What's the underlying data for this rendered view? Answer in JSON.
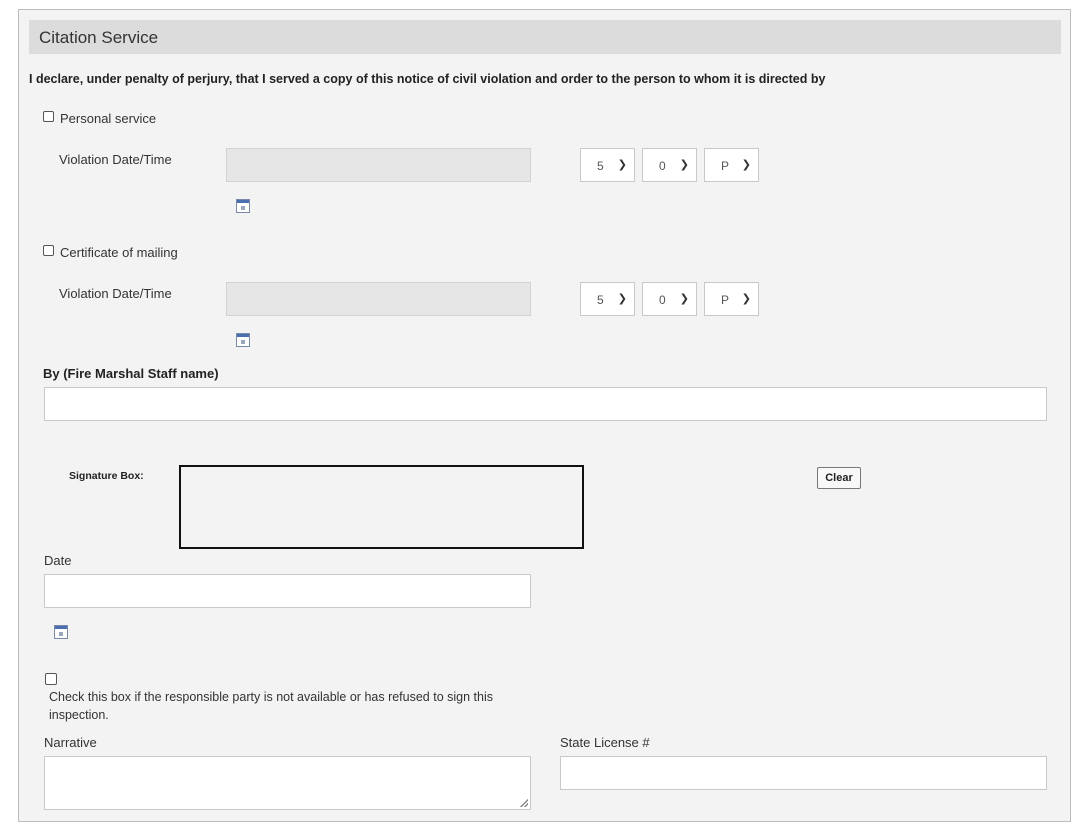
{
  "panel": {
    "title": "Citation Service"
  },
  "declaration": "I declare, under penalty of perjury, that I served a copy of this notice of civil violation and order to the person to whom it is directed by",
  "personal_service": {
    "checkbox_label": "Personal service",
    "violation_label": "Violation Date/Time",
    "date_value": "",
    "hour": "5",
    "minute": "0",
    "ampm": "P"
  },
  "certificate_mailing": {
    "checkbox_label": "Certificate of mailing",
    "violation_label": "Violation Date/Time",
    "date_value": "",
    "hour": "5",
    "minute": "0",
    "ampm": "P"
  },
  "staff": {
    "label": "By (Fire Marshal Staff name)",
    "value": ""
  },
  "signature": {
    "label": "Signature Box:",
    "clear_label": "Clear"
  },
  "date": {
    "label": "Date",
    "value": ""
  },
  "refuse": {
    "label": "Check this box if the responsible party is not available or has refused to sign this inspection."
  },
  "narrative": {
    "label": "Narrative",
    "value": ""
  },
  "license": {
    "label": "State License #",
    "value": ""
  },
  "icons": {
    "calendar": "calendar-icon",
    "chevron": "chevron-down-icon"
  }
}
